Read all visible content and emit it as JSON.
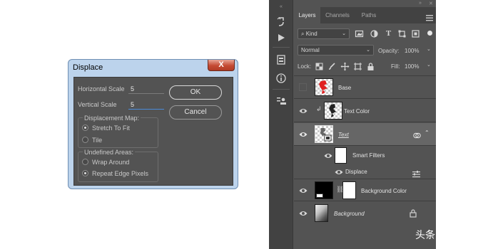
{
  "dialog": {
    "title": "Displace",
    "close_label": "X",
    "horizontal_scale": {
      "label": "Horizontal Scale",
      "value": "5"
    },
    "vertical_scale": {
      "label": "Vertical Scale",
      "value": "5"
    },
    "ok_label": "OK",
    "cancel_label": "Cancel",
    "displacement_map": {
      "title": "Displacement Map:",
      "options": [
        "Stretch To Fit",
        "Tile"
      ],
      "selected": "Stretch To Fit"
    },
    "undefined_areas": {
      "title": "Undefined Areas:",
      "options": [
        "Wrap Around",
        "Repeat Edge Pixels"
      ],
      "selected": "Repeat Edge Pixels"
    }
  },
  "panel": {
    "tabs": [
      "Layers",
      "Channels",
      "Paths"
    ],
    "active_tab": "Layers",
    "filter_kind": "Kind",
    "blend_mode": "Normal",
    "opacity": {
      "label": "Opacity:",
      "value": "100%"
    },
    "lock_label": "Lock:",
    "fill": {
      "label": "Fill:",
      "value": "100%"
    },
    "layers": [
      {
        "name": "Base",
        "visible": false
      },
      {
        "name": "Text Color",
        "visible": true
      },
      {
        "name": "Text",
        "visible": true,
        "selected": true
      },
      {
        "name": "Smart Filters",
        "visible": true
      },
      {
        "name": "Displace",
        "visible": true
      },
      {
        "name": "Background Color",
        "visible": true
      },
      {
        "name": "Background",
        "visible": true,
        "locked": true
      }
    ]
  },
  "watermark": "头条 @设绘谣",
  "colors": {
    "dialog_frame": "#bcd3ec",
    "dialog_body": "#535353",
    "close_button": "#c54a33",
    "panel_bg": "#535353",
    "selected_layer": "#666666",
    "base_thumb_red": "#e02020"
  }
}
